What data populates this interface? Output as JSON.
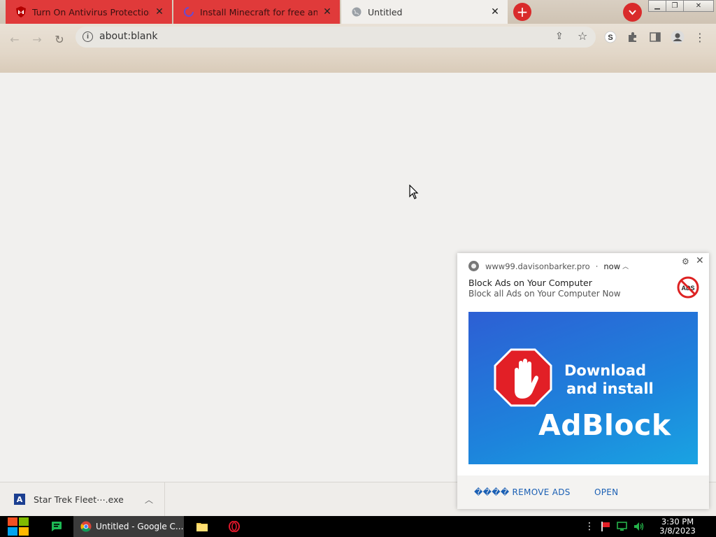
{
  "browser": {
    "tabs": [
      {
        "title": "Turn On Antivirus Protection",
        "favicon": "mcafee-shield-icon"
      },
      {
        "title": "Install Minecraft for free and st",
        "favicon": "spinner-icon"
      },
      {
        "title": "Untitled",
        "favicon": "globe-icon"
      }
    ],
    "new_tab": "+",
    "address": "about:blank"
  },
  "download": {
    "filename": "Star Trek Fleet⋯.exe"
  },
  "notification": {
    "source": "www99.davisonbarker.pro",
    "time": "now",
    "title": "Block Ads on Your Computer",
    "body": "Block all Ads on Your Computer Now",
    "icon_text": "ADS",
    "banner": {
      "line1": "Download",
      "line2": "and install",
      "line3": "AdBlock"
    },
    "actions": {
      "remove": "���� REMOVE ADS",
      "open": "OPEN"
    }
  },
  "taskbar": {
    "chrome_label": "Untitled - Google C...",
    "time": "3:30 PM",
    "date": "3/8/2023"
  },
  "colors": {
    "red_tab": "#e03a3a",
    "accent_red": "#d92b2b",
    "link_blue": "#1a5fb4"
  }
}
